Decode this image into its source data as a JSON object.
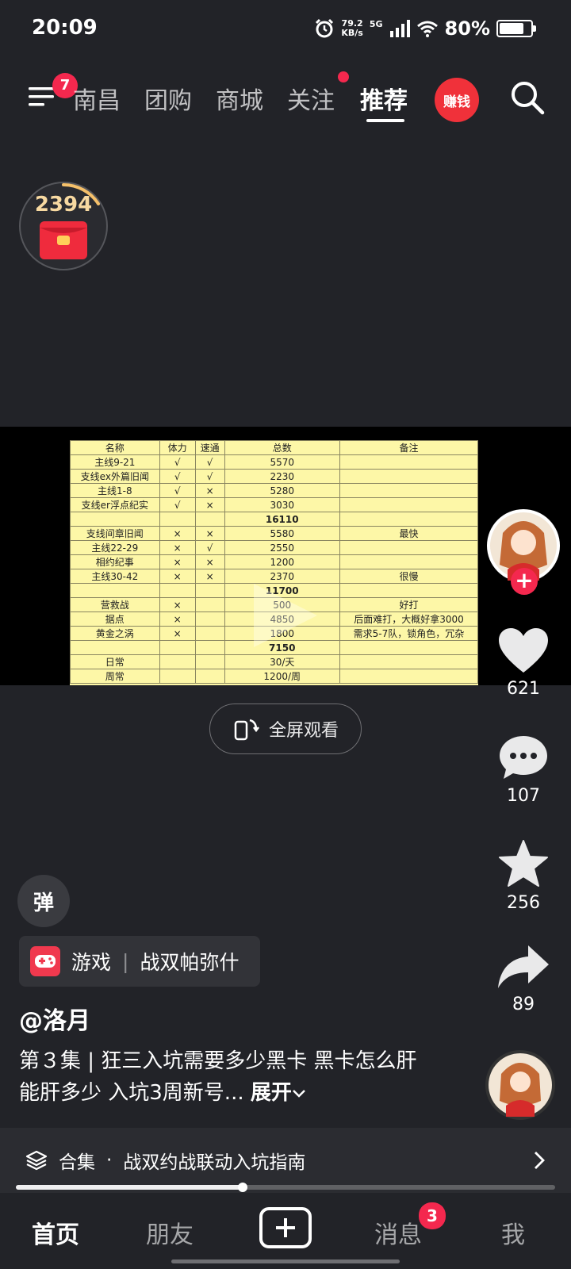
{
  "status_bar": {
    "time": "20:09",
    "net_speed_value": "79.2",
    "net_speed_unit": "KB/s",
    "network": "5G",
    "battery": "80%",
    "battery_level": 0.8
  },
  "top_nav": {
    "menu_badge": "7",
    "tabs": [
      "南昌",
      "团购",
      "商城",
      "关注",
      "推荐"
    ],
    "active_tab": "推荐",
    "earn_label": "赚钱"
  },
  "reward": {
    "count": "2394"
  },
  "sheet": {
    "headers": [
      "名称",
      "体力",
      "速通",
      "总数",
      "备注"
    ],
    "rows": [
      [
        "主线9-21",
        "√",
        "√",
        "5570",
        ""
      ],
      [
        "支线ex外篇旧闻",
        "√",
        "√",
        "2230",
        ""
      ],
      [
        "主线1-8",
        "√",
        "×",
        "5280",
        ""
      ],
      [
        "支线er浮点纪实",
        "√",
        "×",
        "3030",
        ""
      ],
      [
        "",
        "",
        "",
        "16110",
        ""
      ],
      [
        "支线间章旧闻",
        "×",
        "×",
        "5580",
        "最快"
      ],
      [
        "主线22-29",
        "×",
        "√",
        "2550",
        ""
      ],
      [
        "相约纪事",
        "×",
        "×",
        "1200",
        ""
      ],
      [
        "主线30-42",
        "×",
        "×",
        "2370",
        "很慢"
      ],
      [
        "",
        "",
        "",
        "11700",
        ""
      ],
      [
        "营救战",
        "×",
        "",
        "500",
        "好打"
      ],
      [
        "据点",
        "×",
        "",
        "4850",
        "后面难打，大概好拿3000"
      ],
      [
        "黄金之涡",
        "×",
        "",
        "1800",
        "需求5-7队，锁角色，冗杂"
      ],
      [
        "",
        "",
        "",
        "7150",
        ""
      ],
      [
        "日常",
        "",
        "",
        "30/天",
        ""
      ],
      [
        "周常",
        "",
        "",
        "1200/周",
        ""
      ]
    ],
    "bold_rows": [
      4,
      9,
      13
    ]
  },
  "fullscreen_label": "全屏观看",
  "actions": {
    "like_count": "621",
    "comment_count": "107",
    "favorite_count": "256",
    "share_count": "89"
  },
  "danmu_label": "弹",
  "game_tag": {
    "category": "游戏",
    "separator": "|",
    "name": "战双帕弥什"
  },
  "author": "@洛月",
  "description": "第３集 | 狂三入坑需要多少黑卡 黑卡怎么肝 能肝多少 入坑3周新号...",
  "expand_label": "展开",
  "collection": {
    "label": "合集",
    "dot": "·",
    "title": "战双约战联动入坑指南"
  },
  "progress": 0.42,
  "bottom_nav": {
    "home": "首页",
    "friends": "朋友",
    "messages": "消息",
    "messages_badge": "3",
    "me": "我"
  }
}
